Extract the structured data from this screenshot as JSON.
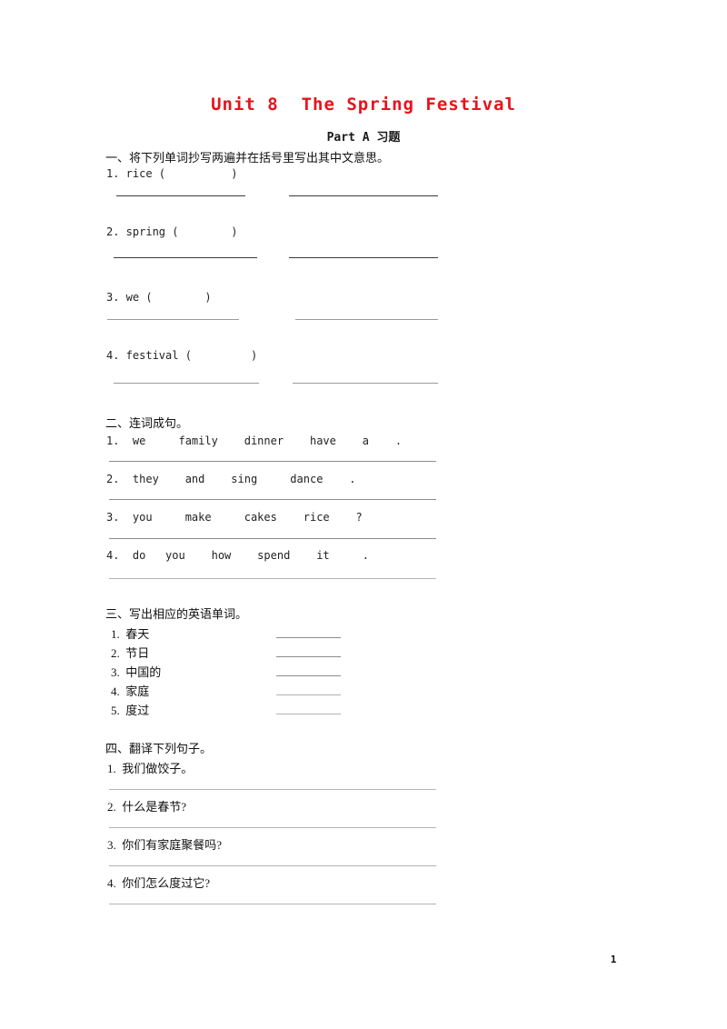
{
  "document": {
    "title": "Unit 8  The Spring Festival",
    "subtitle": "Part A 习题",
    "title_color": "#e8121a",
    "page_number": "1"
  },
  "section1": {
    "heading": "一、将下列单词抄写两遍并在括号里写出其中文意思。",
    "items": [
      {
        "number": "1.",
        "word": "rice",
        "paren_open": "(",
        "paren_close": ")"
      },
      {
        "number": "2.",
        "word": "spring",
        "paren_open": "(",
        "paren_close": ")"
      },
      {
        "number": "3.",
        "word": "we",
        "paren_open": "(",
        "paren_close": ")"
      },
      {
        "number": "4.",
        "word": "festival",
        "paren_open": "(",
        "paren_close": ")"
      }
    ],
    "item_lines": [
      "1. rice (          )",
      "2. spring (        )",
      "3. we (        )",
      "4. festival (         )"
    ]
  },
  "section2": {
    "heading": "二、连词成句。",
    "items": [
      {
        "number": "1.",
        "words": [
          "we",
          "family",
          "dinner",
          "have",
          "a"
        ],
        "punctuation": ".",
        "text": "1.  we     family    dinner    have    a    ."
      },
      {
        "number": "2.",
        "words": [
          "they",
          "and",
          "sing",
          "dance"
        ],
        "punctuation": ".",
        "text": "2.  they    and    sing     dance    ."
      },
      {
        "number": "3.",
        "words": [
          "you",
          "make",
          "cakes",
          "rice"
        ],
        "punctuation": "?",
        "text": "3.  you     make     cakes    rice    ?"
      },
      {
        "number": "4.",
        "words": [
          "do",
          "you",
          "how",
          "spend",
          "it"
        ],
        "punctuation": ".",
        "text": "4.  do   you    how    spend    it     ."
      }
    ]
  },
  "section3": {
    "heading": "三、写出相应的英语单词。",
    "items": [
      {
        "number": "1.",
        "chinese": "春天",
        "text": "1.  春天"
      },
      {
        "number": "2.",
        "chinese": "节日",
        "text": "2.  节日"
      },
      {
        "number": "3.",
        "chinese": "中国的",
        "text": "3.  中国的"
      },
      {
        "number": "4.",
        "chinese": "家庭",
        "text": "4.  家庭"
      },
      {
        "number": "5.",
        "chinese": "度过",
        "text": "5.  度过"
      }
    ]
  },
  "section4": {
    "heading": "四、翻译下列句子。",
    "items": [
      {
        "number": "1.",
        "chinese": "我们做饺子。",
        "text": "1.  我们做饺子。"
      },
      {
        "number": "2.",
        "chinese": "什么是春节?",
        "text": "2.  什么是春节?"
      },
      {
        "number": "3.",
        "chinese": "你们有家庭聚餐吗?",
        "text": "3.  你们有家庭聚餐吗?"
      },
      {
        "number": "4.",
        "chinese": "你们怎么度过它?",
        "text": "4.  你们怎么度过它?"
      }
    ]
  }
}
